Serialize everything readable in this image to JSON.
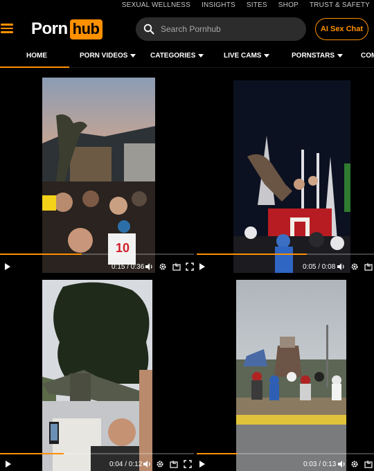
{
  "top_links": [
    "SEXUAL WELLNESS",
    "INSIGHTS",
    "SITES",
    "SHOP",
    "TRUST & SAFETY"
  ],
  "logo": {
    "part1": "Porn",
    "part2": "hub"
  },
  "search": {
    "placeholder": "Search Pornhub"
  },
  "ai_button": "AI Sex Chat",
  "nav": [
    {
      "label": "HOME",
      "caret": false,
      "active": true
    },
    {
      "label": "PORN VIDEOS",
      "caret": true
    },
    {
      "label": "CATEGORIES",
      "caret": true
    },
    {
      "label": "LIVE CAMS",
      "caret": true
    },
    {
      "label": "PORNSTARS",
      "caret": true
    },
    {
      "label": "COM",
      "caret": false
    }
  ],
  "videos": [
    {
      "time": "0:15 / 0:36",
      "progress": 0.42
    },
    {
      "time": "0:05 / 0:08",
      "progress": 0.62
    },
    {
      "time": "0:04 / 0:12",
      "progress": 0.33
    },
    {
      "time": "0:03 / 0:13",
      "progress": 0.23
    }
  ],
  "colors": {
    "accent": "#ff9000",
    "background": "#000000",
    "search_bg": "#2c2c2c"
  }
}
